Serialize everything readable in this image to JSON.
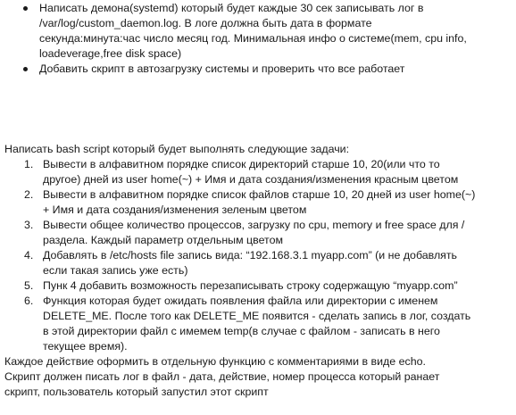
{
  "top_bullets": [
    {
      "lines": [
        "Написать демона(systemd) который будет каждые 30 сек записывать лог в",
        "/var/log/custom_daemon.log. В логе должна быть дата в формате",
        "секунда:минута:час число месяц год.  Минимальная инфо о системе(mem, cpu info,",
        "loadeverage,free disk space)"
      ]
    },
    {
      "lines": [
        "Добавить скрипт в автозагрузку системы и проверить что все работает"
      ]
    }
  ],
  "task_intro": "Написать bash script который будет выполнять следующие задачи:",
  "tasks": [
    {
      "number": "1.",
      "lines": [
        "Вывести в алфавитном порядке список директорий старше 10, 20(или что то",
        "другое) дней из user home(~) + Имя и дата создания/изменения красным цветом"
      ]
    },
    {
      "number": "2.",
      "lines": [
        "Вывести в алфавитном порядке список файлов старше 10, 20 дней из user home(~)",
        "+ Имя и дата создания/изменения зеленым цветом"
      ]
    },
    {
      "number": "3.",
      "lines": [
        "Вывести общее количество процессов, загрузку по cpu, memory и free space для /",
        "раздела. Каждый параметр отдельным цветом"
      ]
    },
    {
      "number": "4.",
      "lines": [
        "Добавлять в /etc/hosts file запись вида: “192.168.3.1 myapp.com” (и не добавлять",
        "если такая запись уже есть)"
      ]
    },
    {
      "number": "5.",
      "lines": [
        "Пунк 4 добавить возможность перезаписывать строку содержащую “myapp.com”"
      ]
    },
    {
      "number": "6.",
      "lines": [
        "Функция которая будет ожидать появления файла или директории с именем",
        "DELETE_ME.  После того как DELETE_ME появится - сделать запись в лог, создать",
        "в этой директории файл с имемем temp(в случае с файлом - записать в него",
        "текущее время)."
      ]
    }
  ],
  "footer_lines": [
    "Каждое действие оформить в отдельную функцию с комментариями в виде echo.",
    "Скрипт должен писать лог в файл -  дата, действие, номер процесса который ранает",
    "скрипт, пользователь который запустил этот скрипт"
  ]
}
